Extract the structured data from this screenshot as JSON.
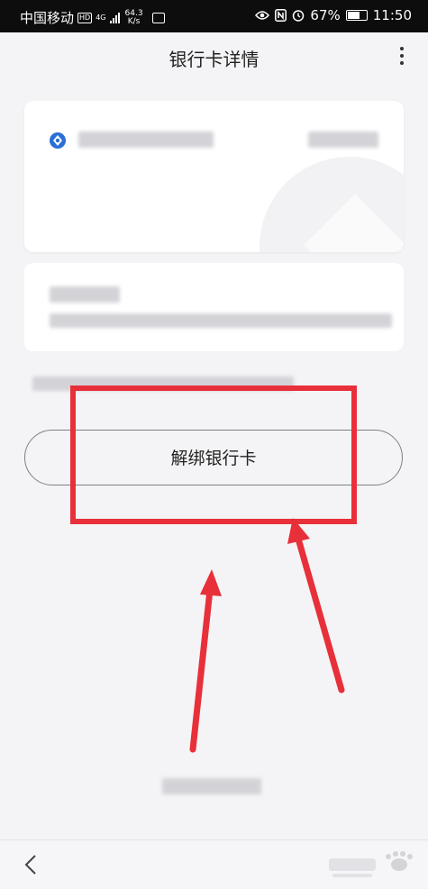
{
  "status_bar": {
    "carrier": "中国移动",
    "hd_badge": "HD",
    "network_type": "4G",
    "speed_value": "64.3",
    "speed_unit": "K/s",
    "battery_percent": "67%",
    "time": "11:50"
  },
  "header": {
    "title": "银行卡详情"
  },
  "actions": {
    "unbind_label": "解绑银行卡"
  },
  "colors": {
    "highlight_red": "#e8303a",
    "bank_logo_blue": "#2a6fd6"
  }
}
